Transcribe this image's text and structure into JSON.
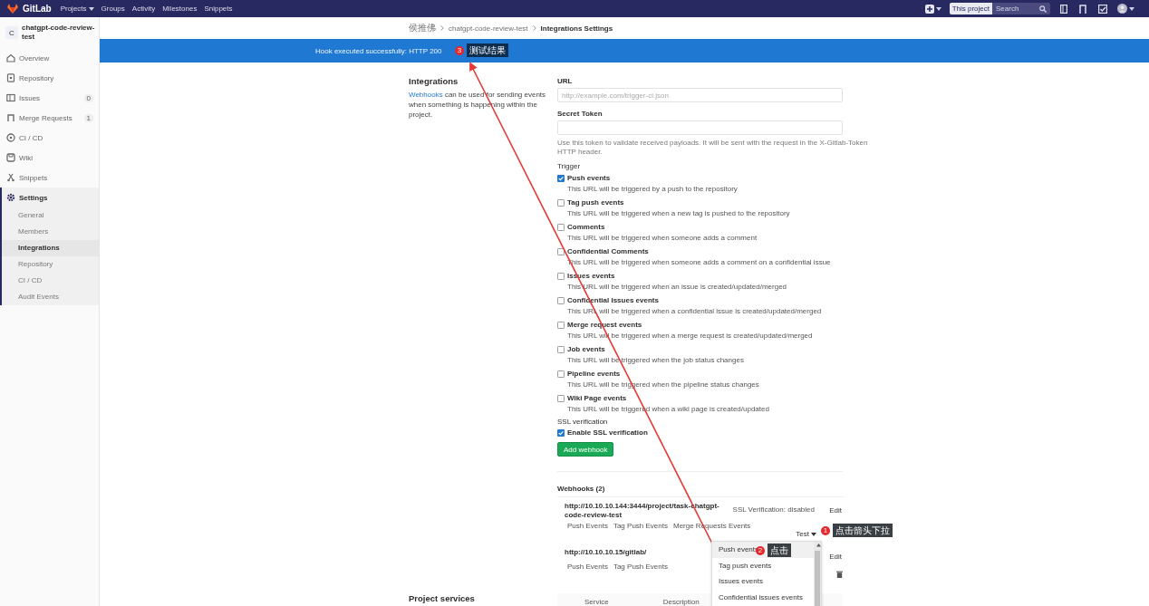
{
  "header": {
    "logo": "GitLab",
    "nav": [
      {
        "label": "Projects",
        "dropdown": true
      },
      {
        "label": "Groups",
        "dropdown": false
      },
      {
        "label": "Activity",
        "dropdown": false
      },
      {
        "label": "Milestones",
        "dropdown": false
      },
      {
        "label": "Snippets",
        "dropdown": false
      }
    ],
    "scope": "This project",
    "search": {
      "placeholder": "Search"
    }
  },
  "sidebar": {
    "avatar_letter": "C",
    "project": "chatgpt-code-review-test",
    "items": [
      {
        "label": "Overview",
        "selected": false
      },
      {
        "label": "Repository",
        "selected": false
      },
      {
        "label": "Issues",
        "count": "0",
        "selected": false
      },
      {
        "label": "Merge Requests",
        "count": "1",
        "selected": false
      },
      {
        "label": "CI / CD",
        "selected": false
      },
      {
        "label": "Wiki",
        "selected": false
      },
      {
        "label": "Snippets",
        "selected": false
      },
      {
        "label": "Settings",
        "selected": true,
        "children": [
          {
            "label": "General",
            "selected": false
          },
          {
            "label": "Members",
            "selected": false
          },
          {
            "label": "Integrations",
            "selected": true
          },
          {
            "label": "Repository",
            "selected": false
          },
          {
            "label": "CI / CD",
            "selected": false
          },
          {
            "label": "Audit Events",
            "selected": false
          }
        ]
      }
    ]
  },
  "breadcrumb": [
    "侯推佛",
    "chatgpt-code-review-test",
    "Integrations Settings"
  ],
  "flash": "Hook executed successfully: HTTP 200",
  "intro": {
    "title": "Integrations",
    "link": "Webhooks",
    "text": "can be used for sending events when something is happening within the project."
  },
  "form": {
    "url": {
      "label": "URL",
      "placeholder": "http://example.com/trigger-ci.json"
    },
    "token": {
      "label": "Secret Token",
      "hint": "Use this token to validate received payloads. It will be sent with the request in the X-Gitlab-Token HTTP header."
    },
    "trigger_label": "Trigger",
    "triggers": [
      {
        "label": "Push events",
        "description": "This URL will be triggered by a push to the repository",
        "checked": true
      },
      {
        "label": "Tag push events",
        "description": "This URL will be triggered when a new tag is pushed to the repository",
        "checked": false
      },
      {
        "label": "Comments",
        "description": "This URL will be triggered when someone adds a comment",
        "checked": false
      },
      {
        "label": "Confidential Comments",
        "description": "This URL will be triggered when someone adds a comment on a confidential issue",
        "checked": false
      },
      {
        "label": "Issues events",
        "description": "This URL will be triggered when an issue is created/updated/merged",
        "checked": false
      },
      {
        "label": "Confidential Issues events",
        "description": "This URL will be triggered when a confidential issue is created/updated/merged",
        "checked": false
      },
      {
        "label": "Merge request events",
        "description": "This URL will be triggered when a merge request is created/updated/merged",
        "checked": false
      },
      {
        "label": "Job events",
        "description": "This URL will be triggered when the job status changes",
        "checked": false
      },
      {
        "label": "Pipeline events",
        "description": "This URL will be triggered when the pipeline status changes",
        "checked": false
      },
      {
        "label": "Wiki Page events",
        "description": "This URL will be triggered when a wiki page is created/updated",
        "checked": false
      }
    ],
    "ssl": {
      "label": "SSL verification",
      "option": "Enable SSL verification",
      "checked": true
    },
    "submit": "Add webhook"
  },
  "webhooks": {
    "title": "Webhooks (2)",
    "items": [
      {
        "url": "http://10.10.10.144:3444/project/task-chatgpt-code-review-test",
        "events": [
          "Push Events",
          "Tag Push Events",
          "Merge Requests Events"
        ],
        "ssl": "SSL Verification: disabled",
        "edit": "Edit",
        "test": "Test"
      },
      {
        "url": "http://10.10.10.15/gitlab/",
        "events": [
          "Push Events",
          "Tag Push Events"
        ],
        "edit": "Edit"
      }
    ]
  },
  "dropdown": {
    "items": [
      {
        "label": "Push events",
        "selected": true
      },
      {
        "label": "Tag push events",
        "selected": false
      },
      {
        "label": "Issues events",
        "selected": false
      },
      {
        "label": "Confidential issues events",
        "selected": false
      }
    ]
  },
  "project_services": {
    "title": "Project services",
    "columns": [
      "Service",
      "Description"
    ]
  },
  "annotations": [
    {
      "number": "1",
      "text": "点击箭头下拉"
    },
    {
      "number": "2",
      "text": "点击"
    },
    {
      "number": "3",
      "text": "测试结果"
    }
  ]
}
